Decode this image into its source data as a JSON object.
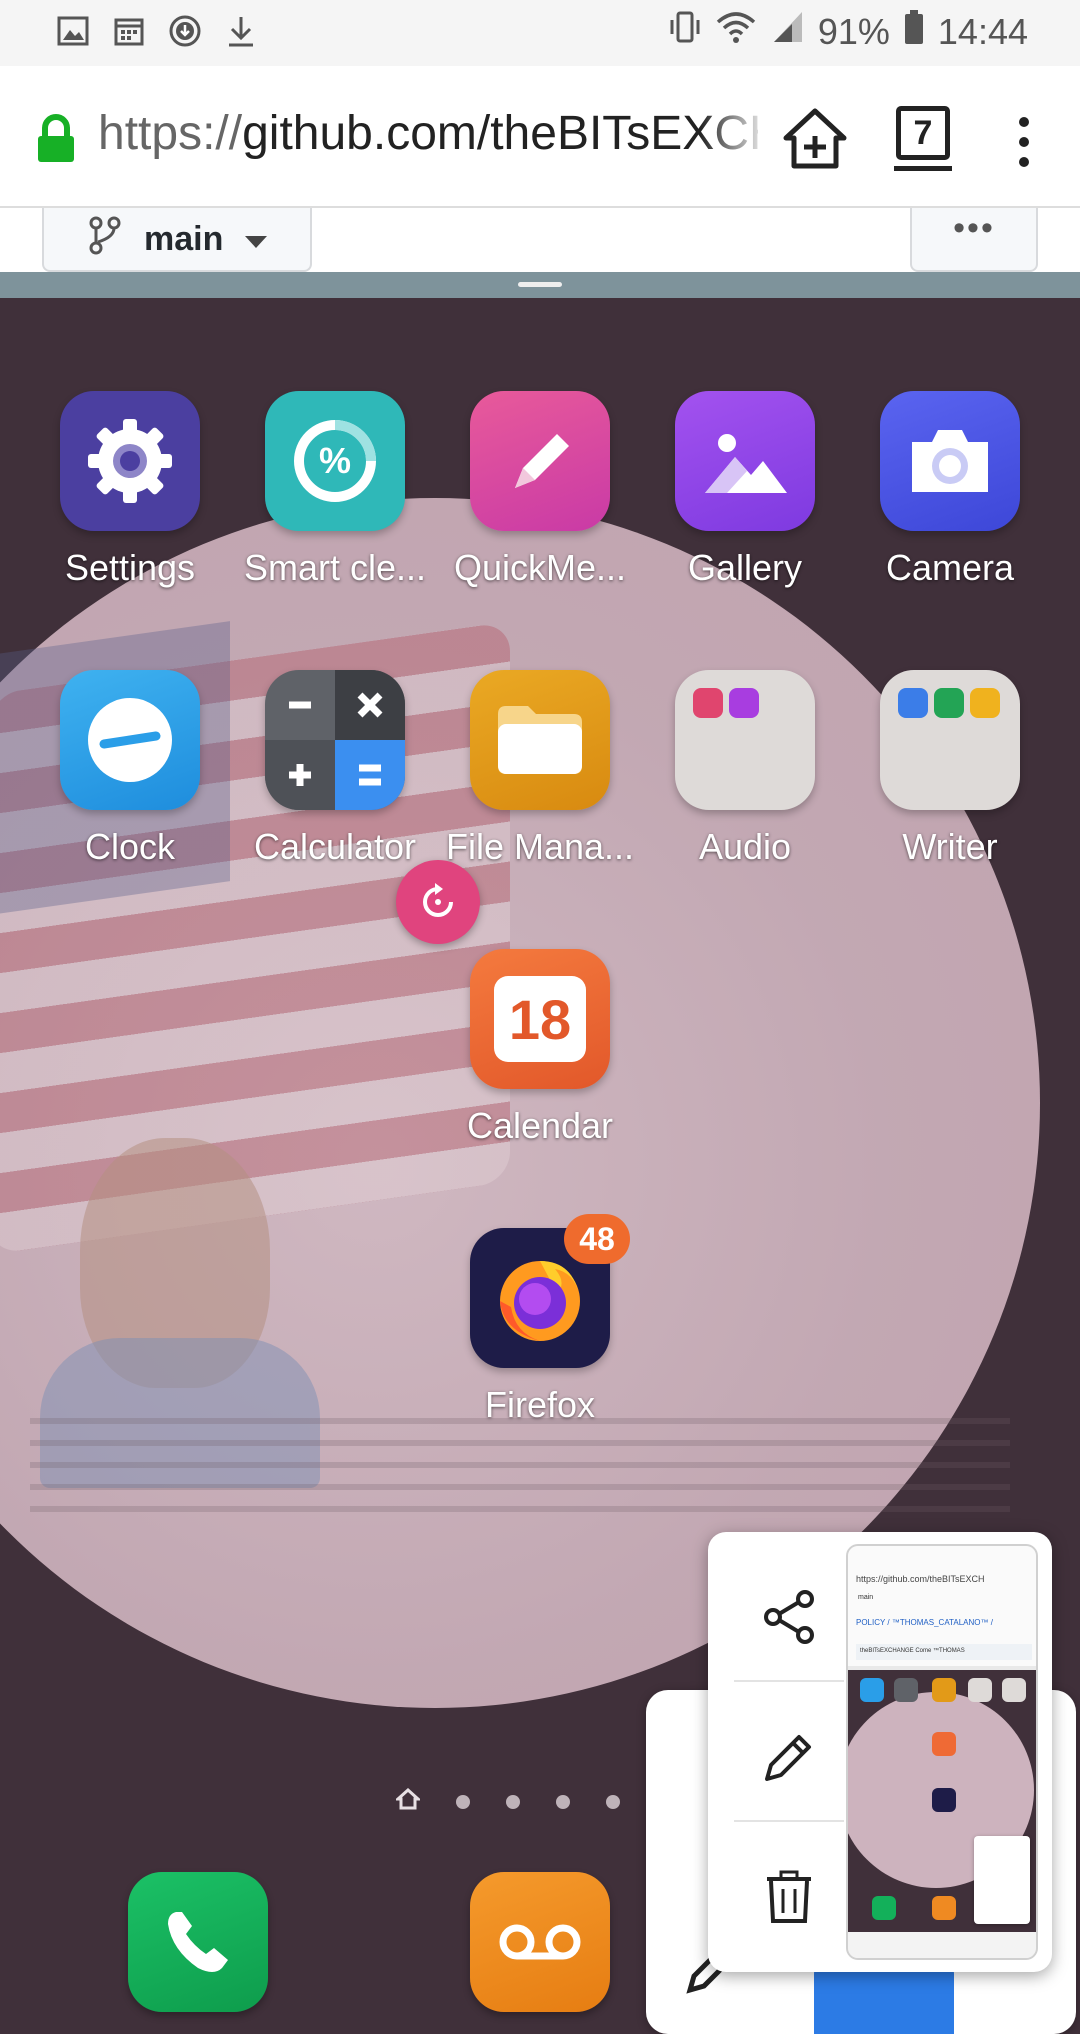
{
  "status_bar": {
    "battery": "91%",
    "time": "14:44",
    "left_icons": [
      "gallery-icon",
      "calendar-icon",
      "download-circle-icon",
      "download-icon"
    ],
    "right_icons": [
      "vibrate-icon",
      "wifi-icon",
      "signal-icon",
      "battery-icon"
    ]
  },
  "browser": {
    "url_scheme": "https://",
    "url_host": "github.com/theBITsEXCH",
    "tab_count": "7"
  },
  "github": {
    "branch": "main",
    "more": "•••"
  },
  "home": {
    "apps": [
      {
        "label": "Settings",
        "icon": "gear-icon",
        "color": "#4b3fa0"
      },
      {
        "label": "Smart cle...",
        "icon": "percent-icon",
        "color": "#2fb8b8"
      },
      {
        "label": "QuickMe...",
        "icon": "pencil-icon",
        "color": "#e0459a"
      },
      {
        "label": "Gallery",
        "icon": "mountain-icon",
        "color": "#9144e8"
      },
      {
        "label": "Camera",
        "icon": "camera-icon",
        "color": "#4c56e8"
      },
      {
        "label": "Clock",
        "icon": "clock-icon",
        "color": "#2a9ee8"
      },
      {
        "label": "Calculator",
        "icon": "calculator-icon",
        "color": "#5f6268"
      },
      {
        "label": "File Mana...",
        "icon": "folder-icon",
        "color": "#e29a18"
      },
      {
        "label": "Audio",
        "icon": "folder-audio-icon",
        "color": "#dedad8"
      },
      {
        "label": "Writer",
        "icon": "folder-writer-icon",
        "color": "#dedad8"
      },
      {
        "label": "Calendar",
        "icon": "calendar-18-icon",
        "color": "#ef6a35",
        "day": "18"
      },
      {
        "label": "Firefox",
        "icon": "firefox-icon",
        "color": "#1e1c48",
        "badge": "48"
      }
    ],
    "page_count": 5,
    "active_page": 1,
    "dock": [
      {
        "name": "phone",
        "icon": "phone-icon",
        "color": "#13b05a"
      },
      {
        "name": "voicemail",
        "icon": "voicemail-icon",
        "color": "#ef8a22"
      }
    ]
  },
  "screenshot_popup": {
    "actions": [
      "share-icon",
      "edit-icon",
      "delete-icon"
    ],
    "thumb": {
      "url": "https://github.com/theBITsEXCH",
      "branch": "main",
      "policy": "POLICY / ™THOMAS_CATALANO™ /",
      "file": "theBITsEXCHANGE Come ™THOMAS"
    }
  }
}
